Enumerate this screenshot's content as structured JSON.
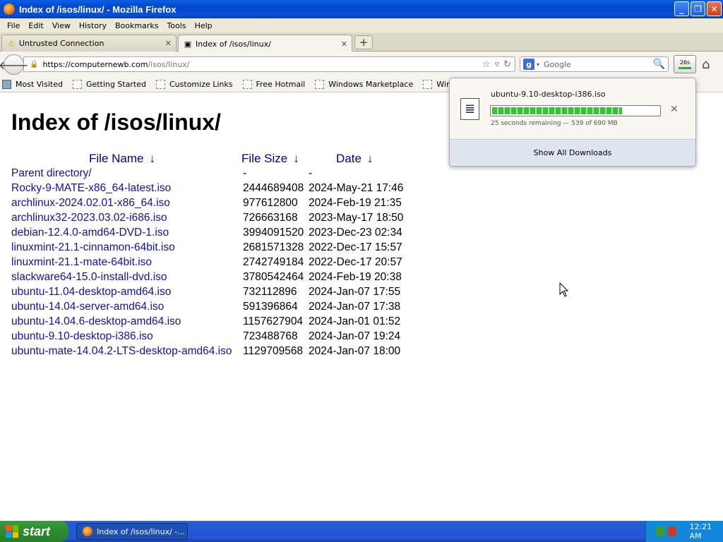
{
  "window": {
    "title": "Index of /isos/linux/ - Mozilla Firefox"
  },
  "menu": [
    "File",
    "Edit",
    "View",
    "History",
    "Bookmarks",
    "Tools",
    "Help"
  ],
  "tabs": [
    {
      "label": "Untrusted Connection",
      "active": false
    },
    {
      "label": "Index of /isos/linux/",
      "active": true
    }
  ],
  "navbar": {
    "url_host": "https://computernewb.com",
    "url_path": "/isos/linux/",
    "search_placeholder": "Google",
    "download_button_label": "26s"
  },
  "bookmarks": [
    "Most Visited",
    "Getting Started",
    "Customize Links",
    "Free Hotmail",
    "Windows Marketplace",
    "Windows Media",
    "W"
  ],
  "page": {
    "title": "Index of /isos/linux/",
    "headers": {
      "name": "File Name",
      "size": "File Size",
      "date": "Date",
      "arrow": "↓"
    },
    "rows": [
      {
        "name": "Parent directory/",
        "size": "-",
        "date": "-"
      },
      {
        "name": "Rocky-9-MATE-x86_64-latest.iso",
        "size": "2444689408",
        "date": "2024-May-21 17:46"
      },
      {
        "name": "archlinux-2024.02.01-x86_64.iso",
        "size": "977612800",
        "date": "2024-Feb-19 21:35"
      },
      {
        "name": "archlinux32-2023.03.02-i686.iso",
        "size": "726663168",
        "date": "2023-May-17 18:50"
      },
      {
        "name": "debian-12.4.0-amd64-DVD-1.iso",
        "size": "3994091520",
        "date": "2023-Dec-23 02:34"
      },
      {
        "name": "linuxmint-21.1-cinnamon-64bit.iso",
        "size": "2681571328",
        "date": "2022-Dec-17 15:57"
      },
      {
        "name": "linuxmint-21.1-mate-64bit.iso",
        "size": "2742749184",
        "date": "2022-Dec-17 20:57"
      },
      {
        "name": "slackware64-15.0-install-dvd.iso",
        "size": "3780542464",
        "date": "2024-Feb-19 20:38"
      },
      {
        "name": "ubuntu-11.04-desktop-amd64.iso",
        "size": "732112896",
        "date": "2024-Jan-07 17:55"
      },
      {
        "name": "ubuntu-14.04-server-amd64.iso",
        "size": "591396864",
        "date": "2024-Jan-07 17:38"
      },
      {
        "name": "ubuntu-14.04.6-desktop-amd64.iso",
        "size": "1157627904",
        "date": "2024-Jan-01 01:52"
      },
      {
        "name": "ubuntu-9.10-desktop-i386.iso",
        "size": "723488768",
        "date": "2024-Jan-07 19:24"
      },
      {
        "name": "ubuntu-mate-14.04.2-LTS-desktop-amd64.iso",
        "size": "1129709568",
        "date": "2024-Jan-07 18:00"
      }
    ]
  },
  "download_panel": {
    "filename": "ubuntu-9.10-desktop-i386.iso",
    "status": "25 seconds remaining — 539 of 690 MB",
    "progress_fraction": 0.78,
    "show_all_label": "Show All Downloads"
  },
  "taskbar": {
    "start_label": "start",
    "task_label": "Index of /isos/linux/ -...",
    "clock": "12:21 AM"
  },
  "icons": {
    "back": "back-arrow-icon",
    "lock": "lock-icon",
    "star": "star-icon",
    "reload": "reload-icon",
    "search": "magnifier-icon",
    "home": "home-icon"
  }
}
